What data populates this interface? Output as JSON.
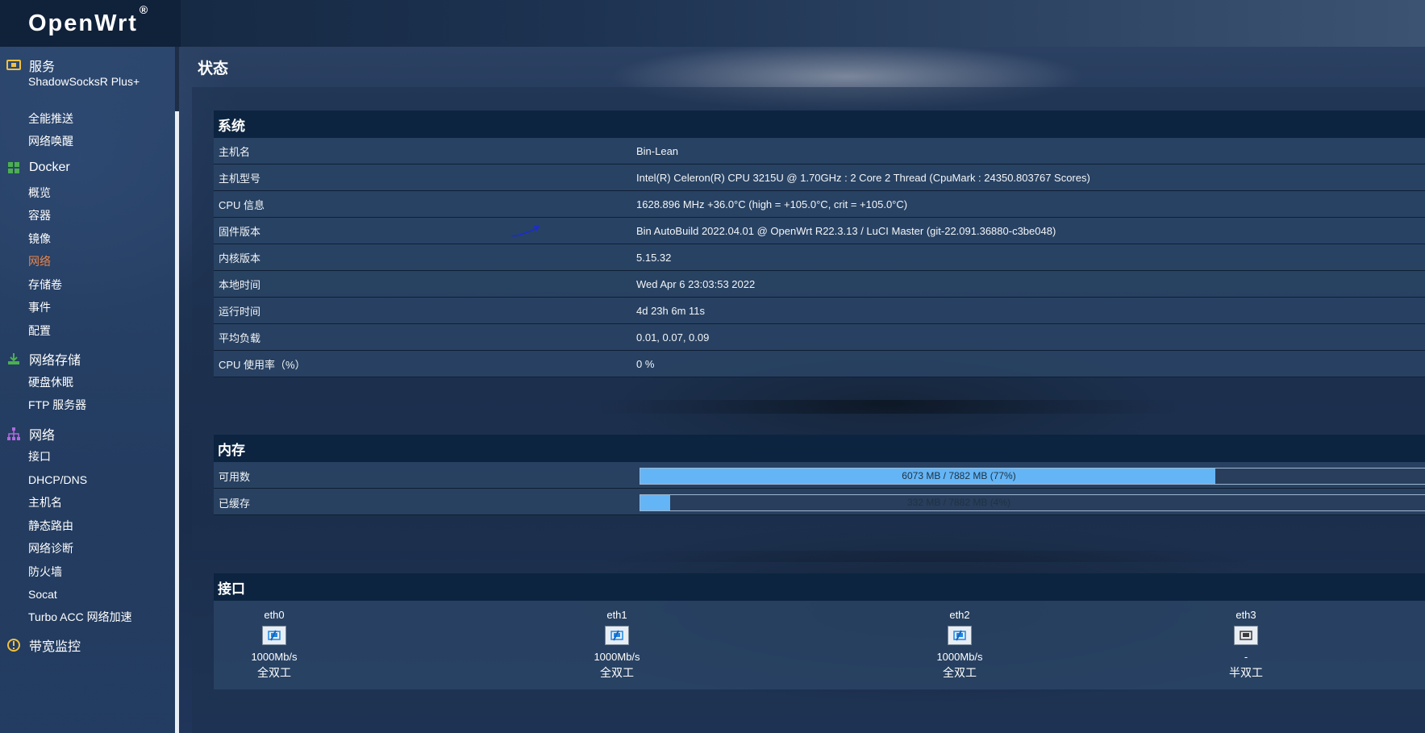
{
  "brand": {
    "name": "OpenWrt",
    "reg": "®"
  },
  "sidebar": {
    "categories": [
      {
        "label": "服务",
        "icon": "services-icon"
      },
      {
        "label": "Docker",
        "icon": "docker-icon"
      },
      {
        "label": "网络存储",
        "icon": "storage-icon"
      },
      {
        "label": "网络",
        "icon": "network-icon"
      },
      {
        "label": "带宽监控",
        "icon": "bandwidth-icon"
      }
    ],
    "services": [
      "ShadowSocksR Plus+",
      "全能推送",
      "网络唤醒"
    ],
    "docker": [
      "概览",
      "容器",
      "镜像",
      "网络",
      "存储卷",
      "事件",
      "配置"
    ],
    "docker_active": "网络",
    "storage": [
      "硬盘休眠",
      "FTP 服务器"
    ],
    "network": [
      "接口",
      "DHCP/DNS",
      "主机名",
      "静态路由",
      "网络诊断",
      "防火墙",
      "Socat",
      "Turbo ACC 网络加速"
    ]
  },
  "page": {
    "title": "状态"
  },
  "system": {
    "title": "系统",
    "rows": [
      {
        "key": "主机名",
        "value": "Bin-Lean"
      },
      {
        "key": "主机型号",
        "value": "Intel(R) Celeron(R) CPU 3215U @ 1.70GHz : 2 Core 2 Thread (CpuMark : 24350.803767 Scores)"
      },
      {
        "key": "CPU 信息",
        "value": "1628.896 MHz +36.0°C (high = +105.0°C, crit = +105.0°C)"
      },
      {
        "key": "固件版本",
        "value": "Bin AutoBuild 2022.04.01 @ OpenWrt R22.3.13 / LuCI Master (git-22.091.36880-c3be048)"
      },
      {
        "key": "内核版本",
        "value": "5.15.32"
      },
      {
        "key": "本地时间",
        "value": "Wed Apr 6 23:03:53 2022"
      },
      {
        "key": "运行时间",
        "value": "4d 23h 6m 11s"
      },
      {
        "key": "平均负载",
        "value": "0.01, 0.07, 0.09"
      },
      {
        "key": "CPU 使用率（%）",
        "value": "0 %"
      }
    ]
  },
  "memory": {
    "title": "内存",
    "available": {
      "label": "可用数",
      "text": "6073 MB / 7882 MB (77%)",
      "fraction": 0.77
    },
    "cached": {
      "label": "已缓存",
      "text": "332 MB / 7882 MB (4%)",
      "fraction": 0.04
    }
  },
  "interfaces": {
    "title": "接口",
    "ports": [
      {
        "name": "eth0",
        "speed": "1000Mb/s",
        "duplex": "全双工",
        "linked": true
      },
      {
        "name": "eth1",
        "speed": "1000Mb/s",
        "duplex": "全双工",
        "linked": true
      },
      {
        "name": "eth2",
        "speed": "1000Mb/s",
        "duplex": "全双工",
        "linked": true
      },
      {
        "name": "eth3",
        "speed": "-",
        "duplex": "半双工",
        "linked": false
      }
    ]
  }
}
